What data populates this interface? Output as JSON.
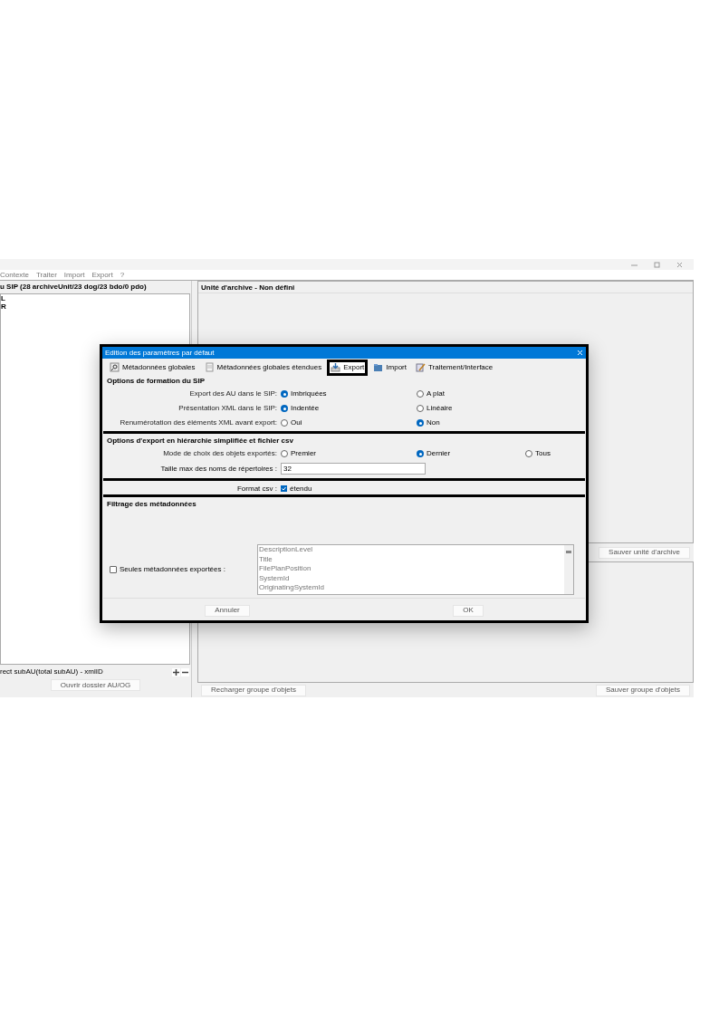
{
  "menu": [
    "Contexte",
    "Traiter",
    "Import",
    "Export",
    "?"
  ],
  "left_panel": {
    "title": "u SIP (28 archiveUnit/23 dog/23 bdo/0 pdo)",
    "tree": [
      {
        "label": "L"
      },
      {
        "label": "R"
      }
    ],
    "footer_text": "rect subAU(total subAU) - xmlID",
    "button": "Ouvrir dossier AU/OG"
  },
  "right_panel": {
    "title": "Unité d'archive - Non défini",
    "save_unit_button": "Sauver unité d'archive",
    "reload_button": "Recharger groupe d'objets",
    "save_group_button": "Sauver groupe d'objets"
  },
  "dialog": {
    "title": "Edition des paramètres par défaut",
    "tabs": [
      {
        "label": "Métadonnées globales",
        "selected": false
      },
      {
        "label": "Métadonnées globales étendues",
        "selected": false
      },
      {
        "label": "Export",
        "selected": true
      },
      {
        "label": "Import",
        "selected": false
      },
      {
        "label": "Traitement/Interface",
        "selected": false
      }
    ],
    "sip_section": {
      "title": "Options de formation du SIP",
      "rows": [
        {
          "label": "Export des AU dans le SIP:",
          "options": [
            {
              "label": "Imbriquées",
              "selected": true
            },
            {
              "label": "A plat",
              "selected": false
            }
          ]
        },
        {
          "label": "Présentation XML dans le SIP:",
          "options": [
            {
              "label": "Indentée",
              "selected": true
            },
            {
              "label": "Linéaire",
              "selected": false
            }
          ]
        },
        {
          "label": "Renumérotation des éléments XML avant export:",
          "options": [
            {
              "label": "Oui",
              "selected": false
            },
            {
              "label": "Non",
              "selected": true
            }
          ]
        }
      ]
    },
    "csv_section": {
      "title": "Options d'export en hiérarchie simplifiée et fichier csv",
      "rows": [
        {
          "label": "Mode de choix des objets exportés:",
          "options": [
            {
              "label": "Premier",
              "selected": false
            },
            {
              "label": "Dernier",
              "selected": true
            },
            {
              "label": "Tous",
              "selected": false
            }
          ]
        }
      ],
      "dir_name_label": "Taille max des noms de répertoires :",
      "dir_name_value": "32"
    },
    "format_csv": {
      "label": "Format csv :",
      "option": "étendu",
      "checked": true
    },
    "filter_section": {
      "title": "Filtrage des métadonnées",
      "checkbox_label": "Seules métadonnées exportées :",
      "checked": false,
      "items": [
        "DescriptionLevel",
        "Title",
        "FilePlanPosition",
        "SystemId",
        "OriginatingSystemId"
      ]
    },
    "buttons": [
      "Annuler",
      "OK"
    ]
  }
}
